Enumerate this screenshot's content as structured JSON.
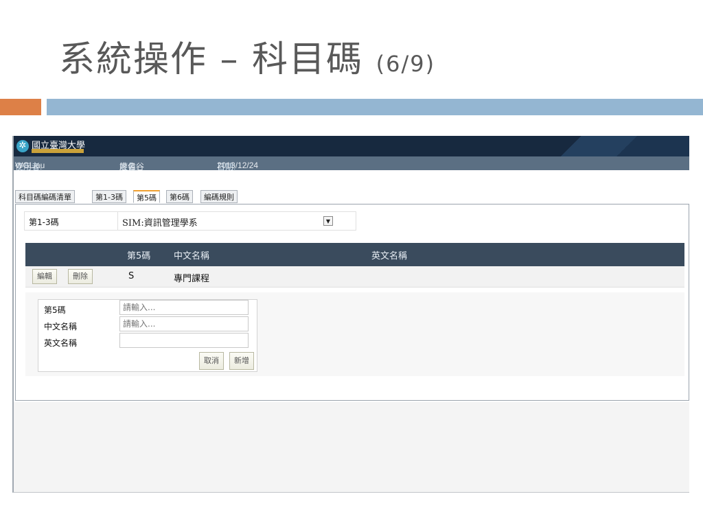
{
  "slide": {
    "title": "系統操作 – 科目碼",
    "page": "(6/9)"
  },
  "colors": {
    "accent_orange": "#dd8047",
    "accent_blue": "#94b6d2",
    "banner": "#17293f",
    "table_header": "#3a4b5d"
  },
  "app": {
    "logo_text": "國立臺灣大學",
    "logo_icon": "university-emblem-icon",
    "user_label": "使用者:",
    "user_value": "WGLiau",
    "name_label": "姓名:",
    "name_value": "廖偉谷",
    "date_label": "日期:",
    "date_value": "2013/12/24"
  },
  "tabs": [
    {
      "label": "科目碼編碼清單",
      "active": false
    },
    {
      "label": "第1-3碼",
      "active": false
    },
    {
      "label": "第5碼",
      "active": true
    },
    {
      "label": "第6碼",
      "active": false
    },
    {
      "label": "編碼規則",
      "active": false
    }
  ],
  "selector": {
    "label": "第1-3碼",
    "value": "SIM:資訊管理學系",
    "arrow": "▼"
  },
  "table": {
    "headers": [
      "第5碼",
      "中文名稱",
      "英文名稱"
    ],
    "rows": [
      {
        "edit_label": "編輯",
        "delete_label": "刪除",
        "code": "S",
        "name_zh": "專門課程",
        "name_en": ""
      }
    ]
  },
  "form": {
    "fields": [
      {
        "label": "第5碼",
        "placeholder": "請輸入..."
      },
      {
        "label": "中文名稱",
        "placeholder": "請輸入..."
      },
      {
        "label": "英文名稱",
        "placeholder": ""
      }
    ],
    "cancel_label": "取消",
    "add_label": "新增"
  }
}
